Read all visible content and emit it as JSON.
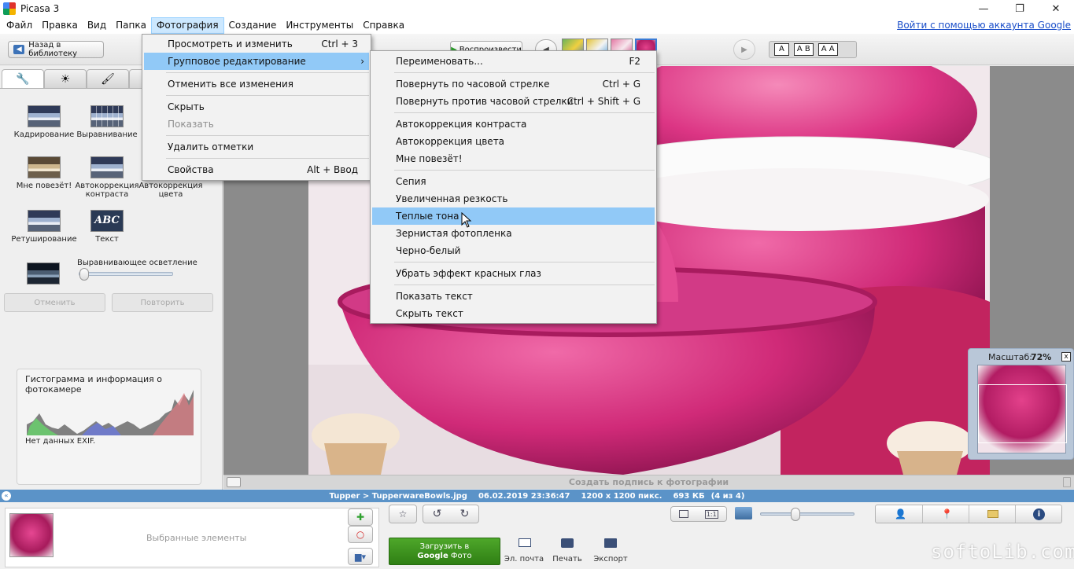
{
  "window": {
    "title": "Picasa 3",
    "minimize": "—",
    "maximize": "❐",
    "close": "✕"
  },
  "menubar": {
    "items": [
      "Файл",
      "Правка",
      "Вид",
      "Папка",
      "Фотография",
      "Создание",
      "Инструменты",
      "Справка"
    ],
    "account_link": "Войти с помощью аккаунта Google"
  },
  "toolbar": {
    "back_label": "Назад в библиотеку",
    "play_label": "Воспроизвести",
    "caption_modes": [
      "A",
      "A B",
      "A A"
    ]
  },
  "photo_menu": {
    "items": [
      {
        "label": "Просмотреть и изменить",
        "shortcut": "Ctrl + 3"
      },
      {
        "label": "Групповое редактирование",
        "shortcut": "›"
      },
      {
        "label": "Отменить все изменения",
        "shortcut": ""
      },
      {
        "label": "Скрыть",
        "shortcut": ""
      },
      {
        "label": "Показать",
        "shortcut": ""
      },
      {
        "label": "Удалить отметки",
        "shortcut": ""
      },
      {
        "label": "Свойства",
        "shortcut": "Alt + Ввод"
      }
    ]
  },
  "batch_menu": {
    "items": [
      {
        "label": "Переименовать...",
        "shortcut": "F2"
      },
      {
        "label": "Повернуть по часовой стрелке",
        "shortcut": "Ctrl + G"
      },
      {
        "label": "Повернуть против часовой стрелки",
        "shortcut": "Ctrl + Shift + G"
      },
      {
        "label": "Автокоррекция контраста",
        "shortcut": ""
      },
      {
        "label": "Автокоррекция цвета",
        "shortcut": ""
      },
      {
        "label": "Мне повезёт!",
        "shortcut": ""
      },
      {
        "label": "Сепия",
        "shortcut": ""
      },
      {
        "label": "Увеличенная резкость",
        "shortcut": ""
      },
      {
        "label": "Теплые тона",
        "shortcut": ""
      },
      {
        "label": "Зернистая фотопленка",
        "shortcut": ""
      },
      {
        "label": "Черно-белый",
        "shortcut": ""
      },
      {
        "label": "Убрать эффект красных глаз",
        "shortcut": ""
      },
      {
        "label": "Показать текст",
        "shortcut": ""
      },
      {
        "label": "Скрыть текст",
        "shortcut": ""
      }
    ]
  },
  "leftpanel": {
    "tools": {
      "crop": "Кадрирование",
      "straighten": "Выравнивание",
      "lucky": "Мне повезёт!",
      "autocontrast": "Автокоррекция контраста",
      "autocolor": "Автокоррекция цвета",
      "retouch": "Ретуширование",
      "text": "Текст",
      "text_icon": "ABC"
    },
    "fill_light_label": "Выравнивающее осветление",
    "fill_light_level": 0,
    "undo": "Отменить",
    "redo": "Повторить",
    "histogram_title": "Гистограмма и информация о фотокамере",
    "exif": "Нет данных EXIF."
  },
  "caption": {
    "placeholder": "Создать подпись к фотографии"
  },
  "zoom": {
    "label": "Масштаб:",
    "value": "72%",
    "close": "x"
  },
  "status": {
    "path": "Tupper > TupperwareBowls.jpg",
    "date": "06.02.2019 23:36:47",
    "dimensions": "1200 x 1200 пикс.",
    "size": "693 КБ",
    "index": "(4 из 4)"
  },
  "bottom": {
    "selected_label": "Выбранные элементы",
    "upload_line1": "Загрузить в",
    "upload_line2_bold": "Google",
    "upload_line2_rest": " Фото",
    "email": "Эл. почта",
    "print": "Печать",
    "export": "Экспорт",
    "zoom_level": 0.35
  },
  "watermark": "softoLib.com",
  "colors": {
    "menu_highlight": "#91c9f7",
    "status_bar": "#5b93c8",
    "upload_green": "#3e8d1e",
    "photo_pink": "#d62c7a"
  }
}
